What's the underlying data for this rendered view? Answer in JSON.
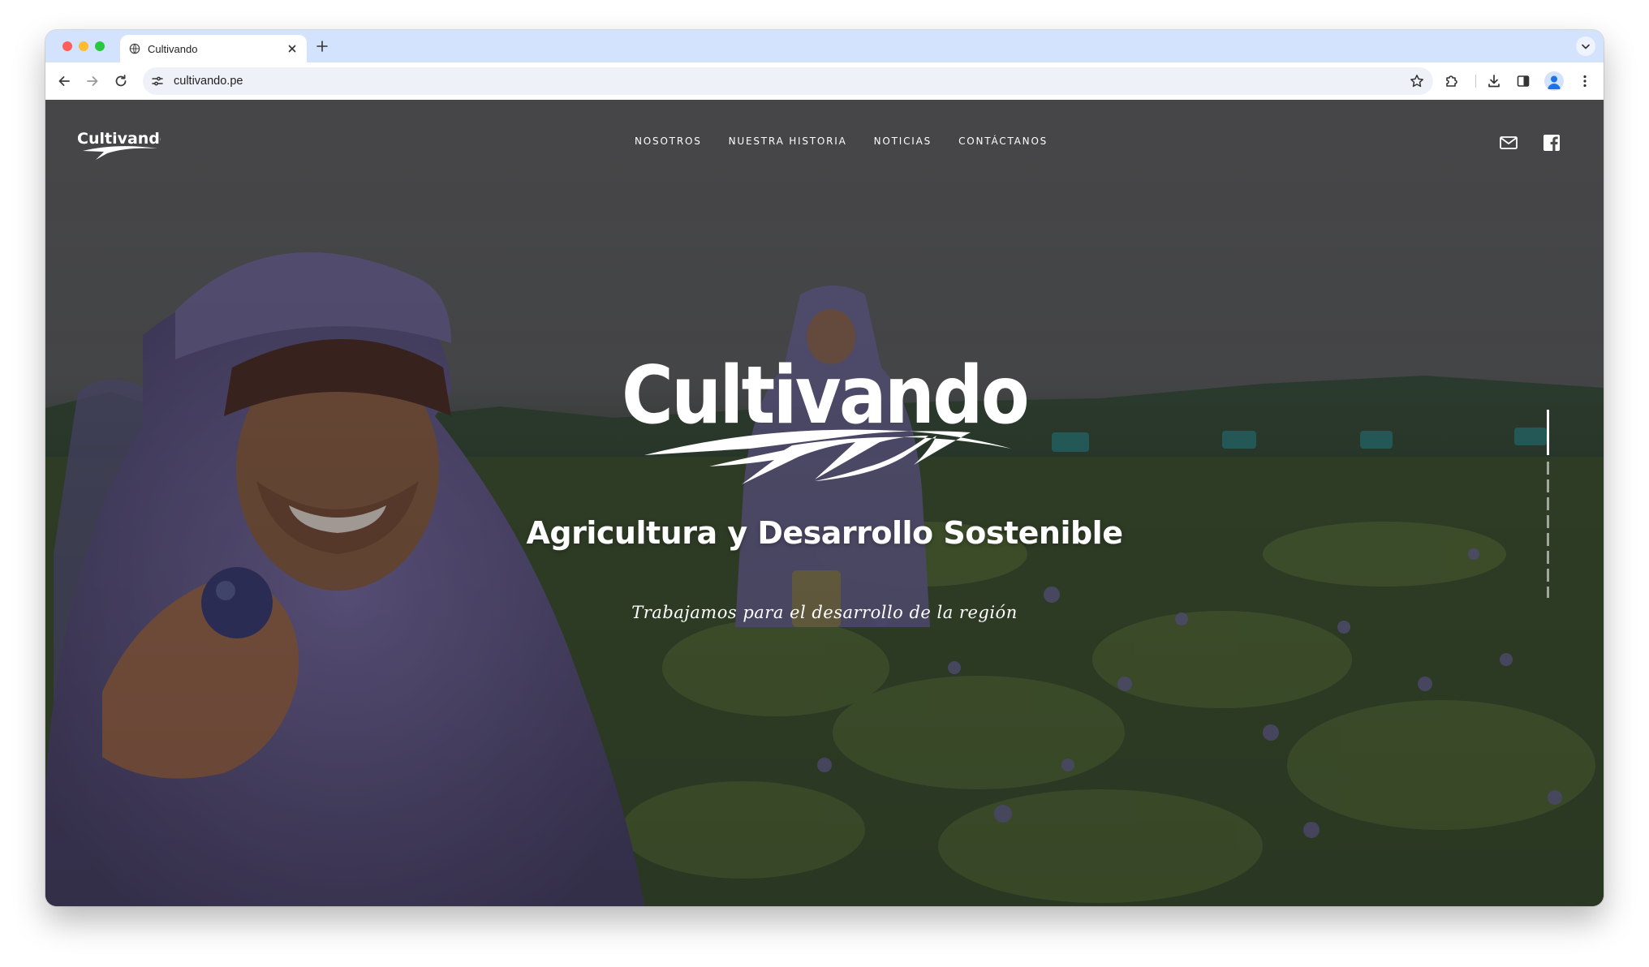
{
  "browser": {
    "tab_title": "Cultivando",
    "url": "cultivando.pe",
    "icons": {
      "new_tab": "plus-icon",
      "back": "arrow-left-icon",
      "forward": "arrow-right-icon",
      "reload": "reload-icon",
      "site_info": "tune-icon",
      "bookmark": "star-icon",
      "extensions": "puzzle-icon",
      "downloads": "download-icon",
      "side_panel": "side-panel-icon",
      "menu": "kebab-menu-icon"
    }
  },
  "site": {
    "logo_text": "Cultivando",
    "nav": [
      "NOSOTROS",
      "NUESTRA HISTORIA",
      "NOTICIAS",
      "CONTÁCTANOS"
    ],
    "social": [
      "mail-icon",
      "facebook-icon"
    ],
    "hero": {
      "logo_text": "Cultivando",
      "title": "Agricultura y Desarrollo Sostenible",
      "subtitle": "Trabajamos para el desarrollo de la región"
    },
    "slider": {
      "slides": 9,
      "active_index": 0
    },
    "colors": {
      "text": "#ffffff",
      "overlay": "#2b2b2b",
      "tab_strip": "#d3e3fd"
    }
  }
}
